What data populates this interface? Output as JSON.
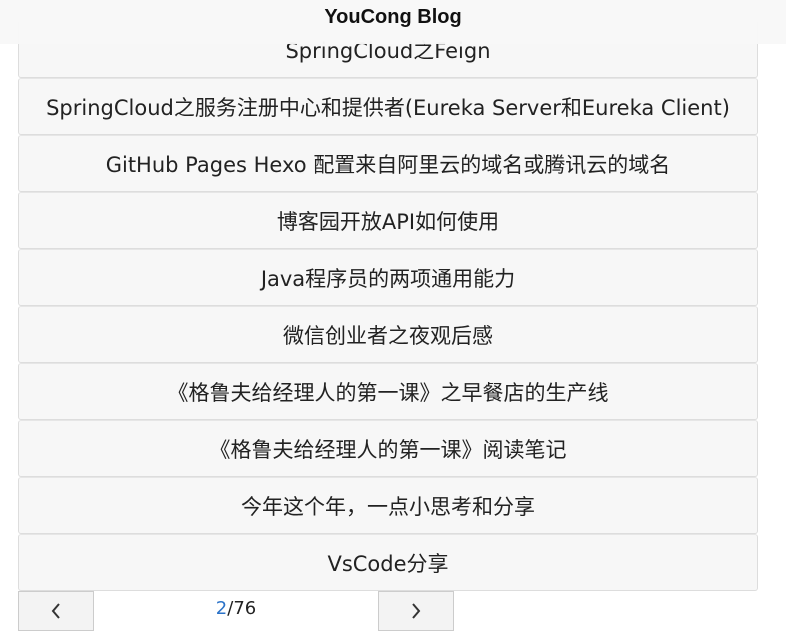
{
  "header": {
    "title": "YouCong Blog"
  },
  "posts": [
    {
      "title": "SpringCloud之Feign"
    },
    {
      "title": "SpringCloud之服务注册中心和提供者(Eureka Server和Eureka Client)"
    },
    {
      "title": "GitHub Pages Hexo 配置来自阿里云的域名或腾讯云的域名"
    },
    {
      "title": "博客园开放API如何使用"
    },
    {
      "title": "Java程序员的两项通用能力"
    },
    {
      "title": "微信创业者之夜观后感"
    },
    {
      "title": "《格鲁夫给经理人的第一课》之早餐店的生产线"
    },
    {
      "title": "《格鲁夫给经理人的第一课》阅读笔记"
    },
    {
      "title": "今年这个年，一点小思考和分享"
    },
    {
      "title": "VsCode分享"
    }
  ],
  "pager": {
    "current": "2",
    "separator": "/",
    "total": "76",
    "prev_icon": "chevron-left-icon",
    "next_icon": "chevron-right-icon",
    "accent_color": "#2a72c8"
  }
}
